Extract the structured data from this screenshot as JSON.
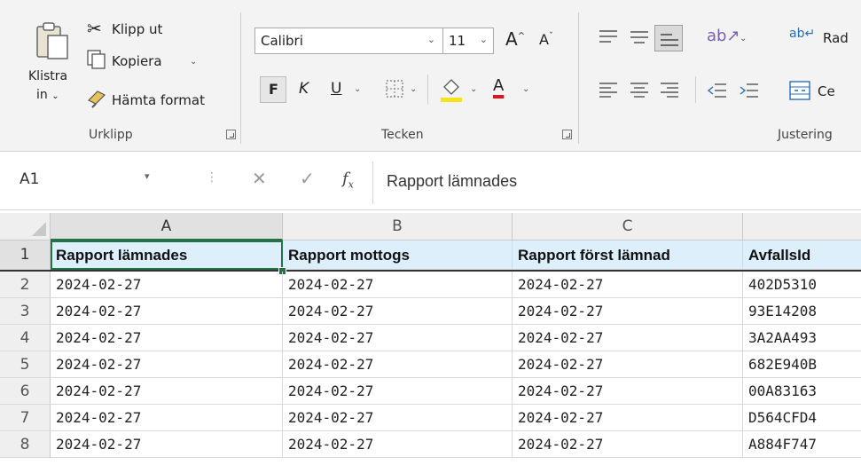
{
  "ribbon": {
    "clipboard": {
      "paste_label_1": "Klistra",
      "paste_label_2": "in",
      "cut": "Klipp ut",
      "copy": "Kopiera",
      "format_painter": "Hämta format",
      "group_label": "Urklipp"
    },
    "font": {
      "font_name": "Calibri",
      "font_size": "11",
      "bold": "F",
      "italic": "K",
      "underline": "U",
      "grow": "A",
      "shrink": "A",
      "group_label": "Tecken",
      "highlight_color": "#f7e31a",
      "font_color": "#e0141e"
    },
    "alignment": {
      "wrap": "Rad",
      "merge": "Ce",
      "group_label": "Justering"
    }
  },
  "formula_bar": {
    "name_box": "A1",
    "fx": "fx",
    "content": "Rapport lämnades"
  },
  "sheet": {
    "columns": [
      "A",
      "B",
      "C",
      ""
    ],
    "header_row": [
      "Rapport lämnades",
      "Rapport mottogs",
      "Rapport först lämnad",
      "AvfallsId"
    ],
    "rows": [
      {
        "n": "1"
      },
      {
        "n": "2",
        "cells": [
          "2024-02-27",
          "2024-02-27",
          "2024-02-27",
          "402D5310"
        ]
      },
      {
        "n": "3",
        "cells": [
          "2024-02-27",
          "2024-02-27",
          "2024-02-27",
          "93E14208"
        ]
      },
      {
        "n": "4",
        "cells": [
          "2024-02-27",
          "2024-02-27",
          "2024-02-27",
          "3A2AA493"
        ]
      },
      {
        "n": "5",
        "cells": [
          "2024-02-27",
          "2024-02-27",
          "2024-02-27",
          "682E940B"
        ]
      },
      {
        "n": "6",
        "cells": [
          "2024-02-27",
          "2024-02-27",
          "2024-02-27",
          "00A83163"
        ]
      },
      {
        "n": "7",
        "cells": [
          "2024-02-27",
          "2024-02-27",
          "2024-02-27",
          "D564CFD4"
        ]
      },
      {
        "n": "8",
        "cells": [
          "2024-02-27",
          "2024-02-27",
          "2024-02-27",
          "A884F747"
        ]
      }
    ]
  },
  "colors": {
    "accent": "#217346",
    "header_fill": "#dceffb"
  }
}
